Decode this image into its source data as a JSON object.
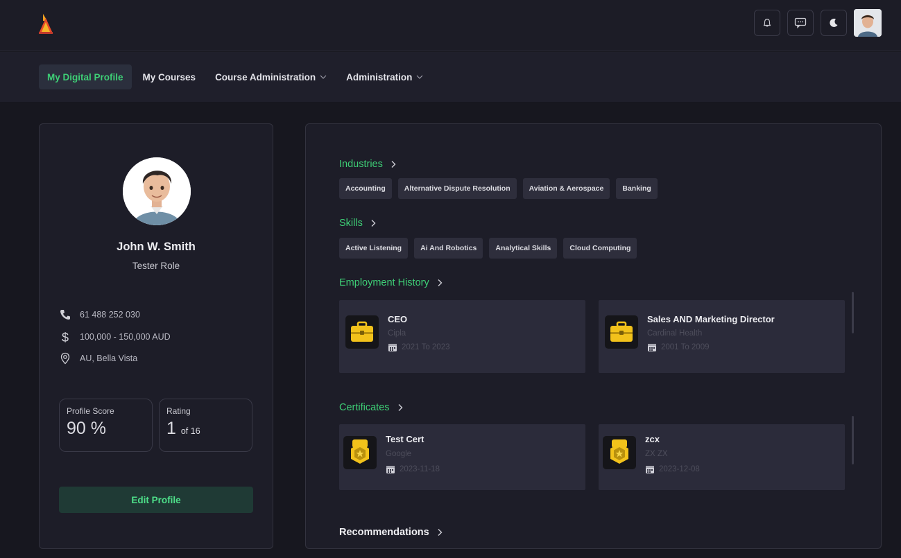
{
  "nav": {
    "items": [
      {
        "label": "My Digital Profile",
        "active": true,
        "dropdown": false
      },
      {
        "label": "My Courses",
        "active": false,
        "dropdown": false
      },
      {
        "label": "Course Administration",
        "active": false,
        "dropdown": true
      },
      {
        "label": "Administration",
        "active": false,
        "dropdown": true
      }
    ]
  },
  "topbar": {
    "icons": [
      "bell-icon",
      "chat-icon",
      "moon-icon"
    ],
    "avatar": "user-avatar"
  },
  "profile": {
    "name": "John W. Smith",
    "role": "Tester Role",
    "phone": "61 488 252 030",
    "salary": "100,000 - 150,000 AUD",
    "location": "AU, Bella Vista",
    "score_label": "Profile Score",
    "score_value": "90 %",
    "rating_label": "Rating",
    "rating_value": "1",
    "rating_of": "of 16",
    "edit_label": "Edit Profile"
  },
  "sections": {
    "industries": {
      "title": "Industries",
      "tags": [
        "Accounting",
        "Alternative Dispute Resolution",
        "Aviation & Aerospace",
        "Banking"
      ]
    },
    "skills": {
      "title": "Skills",
      "tags": [
        "Active Listening",
        "Ai And Robotics",
        "Analytical Skills",
        "Cloud Computing"
      ]
    },
    "employment": {
      "title": "Employment History",
      "items": [
        {
          "title": "CEO",
          "company": "Cipla",
          "dates": "2021 To 2023"
        },
        {
          "title": "Sales AND Marketing Director",
          "company": "Cardinal Health",
          "dates": "2001 To 2009"
        }
      ]
    },
    "certificates": {
      "title": "Certificates",
      "items": [
        {
          "title": "Test Cert",
          "issuer": "Google",
          "date": "2023-11-18"
        },
        {
          "title": "zcx",
          "issuer": "ZX ZX",
          "date": "2023-12-08"
        }
      ]
    },
    "recommendations": {
      "title": "Recommendations"
    }
  },
  "colors": {
    "accent": "#3ecf76",
    "background": "#17171f",
    "card": "#1d1d28",
    "tag": "#2e2e3c"
  }
}
